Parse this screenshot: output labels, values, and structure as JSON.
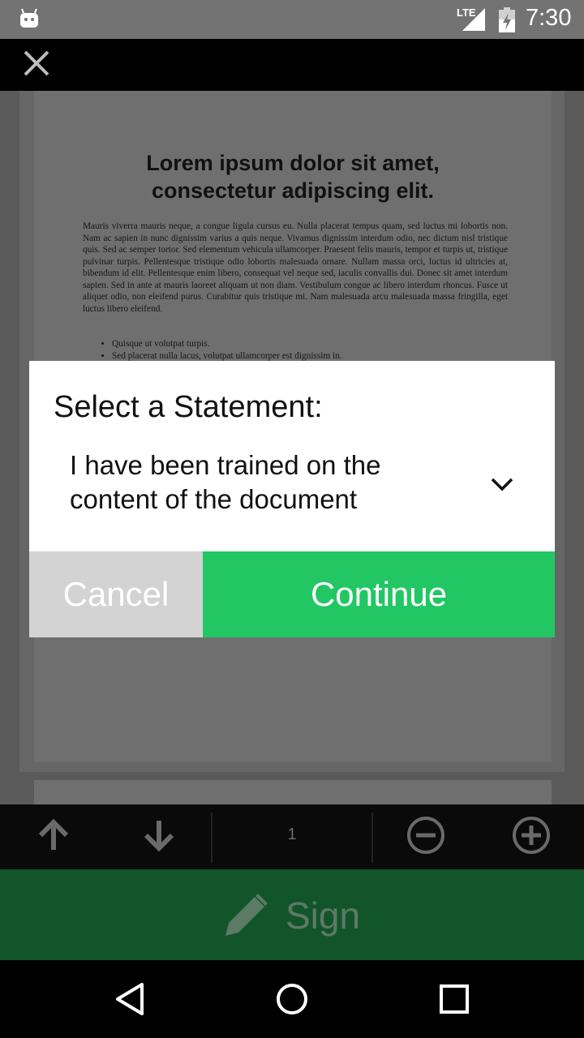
{
  "status_bar": {
    "network": "LTE",
    "time": "7:30"
  },
  "icons": {
    "notification": "android-robot-icon",
    "signal": "cell-signal-icon",
    "battery": "battery-charging-icon",
    "close": "close-icon",
    "chevron": "chevron-down-icon",
    "up": "arrow-up-icon",
    "down": "arrow-down-icon",
    "zoom_out": "zoom-out-icon",
    "zoom_in": "zoom-in-icon",
    "sign": "pencil-icon",
    "back": "back-icon",
    "home": "home-icon",
    "recents": "recents-icon"
  },
  "document": {
    "title_line1": "Lorem ipsum dolor sit amet,",
    "title_line2": "consectetur adipiscing elit.",
    "body": "Mauris viverra mauris neque, a congue ligula cursus eu. Nulla placerat tempus quam, sed luctus mi lobortis non. Nam ac sapien in nunc dignissim varius a quis neque. Vivamus dignissim interdum odio, nec dictum nisl tristique quis. Sed ac semper tortor. Sed elementum vehicula ullamcorper. Praesent felis mauris, tempor et turpis ut, tristique pulvinar turpis. Pellentesque tristique odio lobortis malesuada ornare. Nullam massa orci, luctus id ultricies at, bibendum id elit. Pellentesque enim libero, consequat vel neque sed, iaculis convallis dui. Donec sit amet interdum sapien. Sed in ante at mauris laoreet aliquam ut non diam. Vestibulum congue ac libero interdum rhoncus. Fusce ut aliquet odio, non eleifend purus. Curabitur quis tristique mi. Nam malesuada arcu malesuada massa fringilla, eget luctus libero eleifend.",
    "list": [
      "Quisque ut volutpat turpis.",
      "Sed placerat nulla lacus, volutpat ullamcorper est dignissim in."
    ]
  },
  "dialog": {
    "title": "Select a Statement:",
    "selected_line1": "I have been trained on the",
    "selected_line2": "content of the document",
    "cancel_label": "Cancel",
    "continue_label": "Continue",
    "continue_color": "#22c764"
  },
  "toolbar": {
    "page_number": "1"
  },
  "sign": {
    "label": "Sign"
  }
}
